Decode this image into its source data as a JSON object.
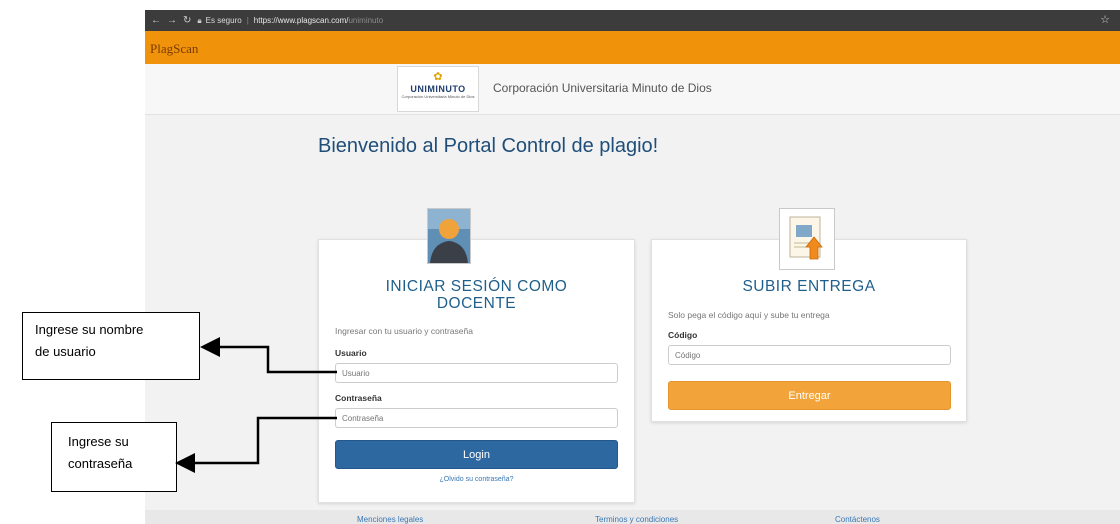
{
  "browser": {
    "secure_label": "Es seguro",
    "url_host": "https://www.plagscan.com/",
    "url_path": "uniminuto"
  },
  "header": {
    "logo_text": "PlagScan"
  },
  "institution": {
    "logo_word": "UNIMINUTO",
    "logo_small": "Corporación Universitaria Minuto de Dios",
    "name": "Corporación Universitaria Minuto de Dios"
  },
  "main": {
    "welcome": "Bienvenido al Portal Control de plagio!"
  },
  "login_card": {
    "title_line1": "INICIAR SESIÓN COMO",
    "title_line2": "DOCENTE",
    "subtitle": "Ingresar con tu usuario y contraseña",
    "username_label": "Usuario",
    "username_placeholder": "Usuario",
    "password_label": "Contraseña",
    "password_placeholder": "Contraseña",
    "login_button": "Login",
    "forgot_link": "¿Olvido su contraseña?"
  },
  "upload_card": {
    "title": "SUBIR ENTREGA",
    "subtitle": "Solo pega el código aquí y sube tu entrega",
    "code_label": "Código",
    "code_placeholder": "Código",
    "submit_button": "Entregar"
  },
  "footer": {
    "legal": "Menciones legales",
    "terms": "Terminos y condiciones",
    "contact": "Contáctenos"
  },
  "callouts": {
    "username_line1": "Ingrese su nombre",
    "username_line2": "de usuario",
    "password_line1": "Ingrese su",
    "password_line2": "contraseña"
  }
}
